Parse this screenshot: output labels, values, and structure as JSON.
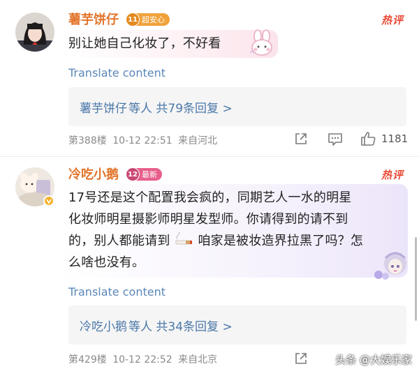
{
  "comments": [
    {
      "username": "薯芋饼仔",
      "level": "11",
      "badge_text": "超安心",
      "hot_tag": "热评",
      "text": "别让她自己化妆了，不好看",
      "translate": "Translate content",
      "replies_name": "薯芋饼仔",
      "replies_suffix": "等人 共79条回复 >",
      "floor": "第388楼",
      "time": "10-12 22:51",
      "location": "来自河北",
      "likes": "1181"
    },
    {
      "username": "冷吃小鹅",
      "level": "12",
      "badge_text": "最新",
      "hot_tag": "热评",
      "text_lines": [
        "17号还是这个配置我会疯的，同期艺人一水的明星",
        "化妆师明星摄影师明星发型师。你请得到的请不到",
        "的，别人都能请到",
        "咱家是被妆造界拉黑了吗？怎",
        "么啥也没有。"
      ],
      "translate": "Translate content",
      "replies_name": "冷吃小鹅",
      "replies_suffix": "等人 共34条回复 >",
      "floor": "第429楼",
      "time": "10-12 22:52",
      "location": "来自北京"
    }
  ],
  "watermark": "头条 @大娱乐家",
  "colors": {
    "username": "#e2742a",
    "link": "#4a77a9",
    "hot": "#ea4a35",
    "badge1": "#f0a23a",
    "badge2": "#e85f8b"
  }
}
